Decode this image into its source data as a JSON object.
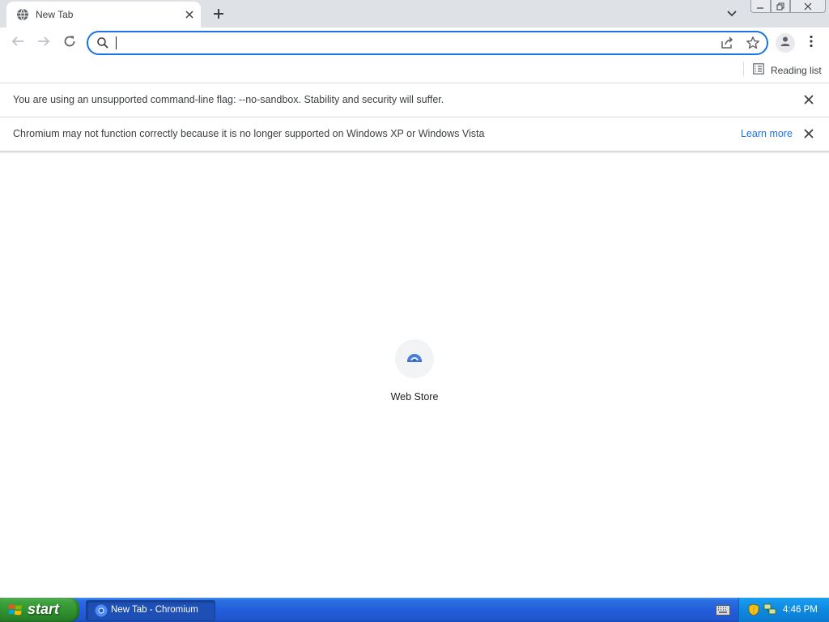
{
  "tab": {
    "title": "New Tab"
  },
  "omnibox": {
    "value": "",
    "placeholder": ""
  },
  "bookmarks": {
    "reading_list_label": "Reading list"
  },
  "infobars": [
    {
      "text": "You are using an unsupported command-line flag: --no-sandbox. Stability and security will suffer.",
      "link": ""
    },
    {
      "text": "Chromium may not function correctly because it is no longer supported on Windows XP or Windows Vista",
      "link": "Learn more"
    }
  ],
  "shortcuts": [
    {
      "label": "Web Store",
      "icon": "web-store-icon"
    }
  ],
  "taskbar": {
    "start_label": "start",
    "tasks": [
      {
        "label": "New Tab - Chromium",
        "icon": "chromium-icon"
      }
    ],
    "clock": "4:46 PM"
  },
  "colors": {
    "accent": "#1a73e8",
    "tabstrip": "#dee1e6",
    "taskbar_blue": "#245edb",
    "start_green": "#3ea43e"
  }
}
